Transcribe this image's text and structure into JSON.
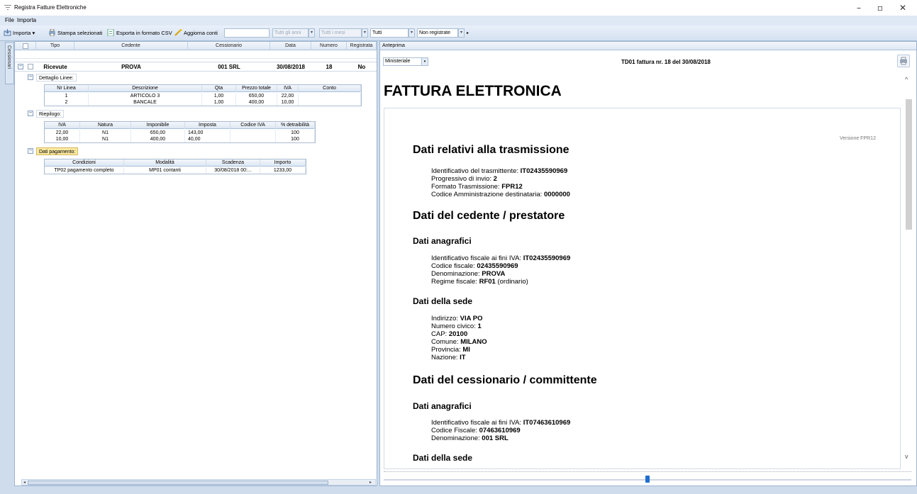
{
  "window": {
    "title": "Registra Fatture Elettroniche",
    "controls": {
      "minimize": "–",
      "maximize": "▫",
      "close": "✕"
    }
  },
  "menu": {
    "items": [
      "File",
      "Importa"
    ]
  },
  "toolbar": {
    "importa": "Importa",
    "stampa": "Stampa selezionati",
    "esporta": "Esporta in formato CSV",
    "aggiorna": "Aggiorna conti",
    "search_value": "",
    "anni": "Tutti gli anni",
    "mesi": "Tutti i mesi",
    "tutti": "Tutti",
    "stato": "Non registrate"
  },
  "side_tab": {
    "label": "Cessionari"
  },
  "grid": {
    "headers": [
      "Tipo",
      "Cedente",
      "Cessionario",
      "Data",
      "Numero",
      "Registrata"
    ],
    "row": {
      "tipo": "Ricevute",
      "cedente": "PROVA",
      "cessionario": "001 SRL",
      "data": "30/08/2018",
      "numero": "18",
      "registrata": "No"
    },
    "dettaglio_label": "Dettaglio Linee:",
    "dettaglio_headers": [
      "Nr Linea",
      "Descrizione",
      "Qta",
      "Prezzo totale",
      "IVA",
      "Conto"
    ],
    "dettaglio_rows": [
      [
        "1",
        "ARTICOLO 3",
        "1,00",
        "650,00",
        "22,00",
        ""
      ],
      [
        "2",
        "BANCALE",
        "1,00",
        "400,00",
        "10,00",
        ""
      ]
    ],
    "riepilogo_label": "Riepilogo:",
    "riepilogo_headers": [
      "IVA",
      "Natura",
      "Imponibile",
      "Imposta",
      "Codice IVA",
      "% detraibilità"
    ],
    "riepilogo_rows": [
      [
        "22,00",
        "N1",
        "650,00",
        "143,00",
        "",
        "100"
      ],
      [
        "10,00",
        "N1",
        "400,00",
        "40,00",
        "",
        "100"
      ]
    ],
    "pagamento_label": "Dati pagamento:",
    "pagamento_headers": [
      "Condizioni",
      "Modalità",
      "Scadenza",
      "Importo"
    ],
    "pagamento_rows": [
      [
        "TP02 pagamento completo",
        "MP01 contanti",
        "30/08/2018 00:...",
        "1233,00"
      ]
    ]
  },
  "preview": {
    "tab_label": "Anteprima",
    "style_select": "Ministeriale",
    "doc_title": "TD01 fattura nr. 18 del 30/08/2018",
    "big_title": "FATTURA ELETTRONICA",
    "version": "Versione FPR12",
    "sections": {
      "trasmissione": "Dati relativi alla trasmissione",
      "cedente": "Dati del cedente / prestatore",
      "cessionario": "Dati del cessionario / committente"
    },
    "subsections": {
      "anagrafici": "Dati anagrafici",
      "sede": "Dati della sede"
    },
    "trasmissione_lines": [
      {
        "label": "Identificativo del trasmittente: ",
        "value": "IT02435590969"
      },
      {
        "label": "Progressivo di invio: ",
        "value": "2"
      },
      {
        "label": "Formato Trasmissione: ",
        "value": "FPR12"
      },
      {
        "label": "Codice Amministrazione destinataria: ",
        "value": "0000000"
      }
    ],
    "cedente_anagrafici": [
      {
        "label": "Identificativo fiscale ai fini IVA: ",
        "value": "IT02435590969"
      },
      {
        "label": "Codice fiscale: ",
        "value": "02435590969"
      },
      {
        "label": "Denominazione: ",
        "value": "PROVA"
      },
      {
        "label": "Regime fiscale: ",
        "value": "RF01",
        "extra": " (ordinario)"
      }
    ],
    "cedente_sede": [
      {
        "label": "Indirizzo: ",
        "value": "VIA PO"
      },
      {
        "label": "Numero civico: ",
        "value": "1"
      },
      {
        "label": "CAP: ",
        "value": "20100"
      },
      {
        "label": "Comune: ",
        "value": "MILANO"
      },
      {
        "label": "Provincia: ",
        "value": "MI"
      },
      {
        "label": "Nazione: ",
        "value": "IT"
      }
    ],
    "cessionario_anagrafici": [
      {
        "label": "Identificativo fiscale ai fini IVA: ",
        "value": "IT07463610969"
      },
      {
        "label": "Codice Fiscale: ",
        "value": "07463610969"
      },
      {
        "label": "Denominazione: ",
        "value": "001 SRL"
      }
    ]
  },
  "colors": {
    "accent": "#1e6fd0",
    "selection": "#fbe9a2",
    "frame": "#cfdcec"
  }
}
